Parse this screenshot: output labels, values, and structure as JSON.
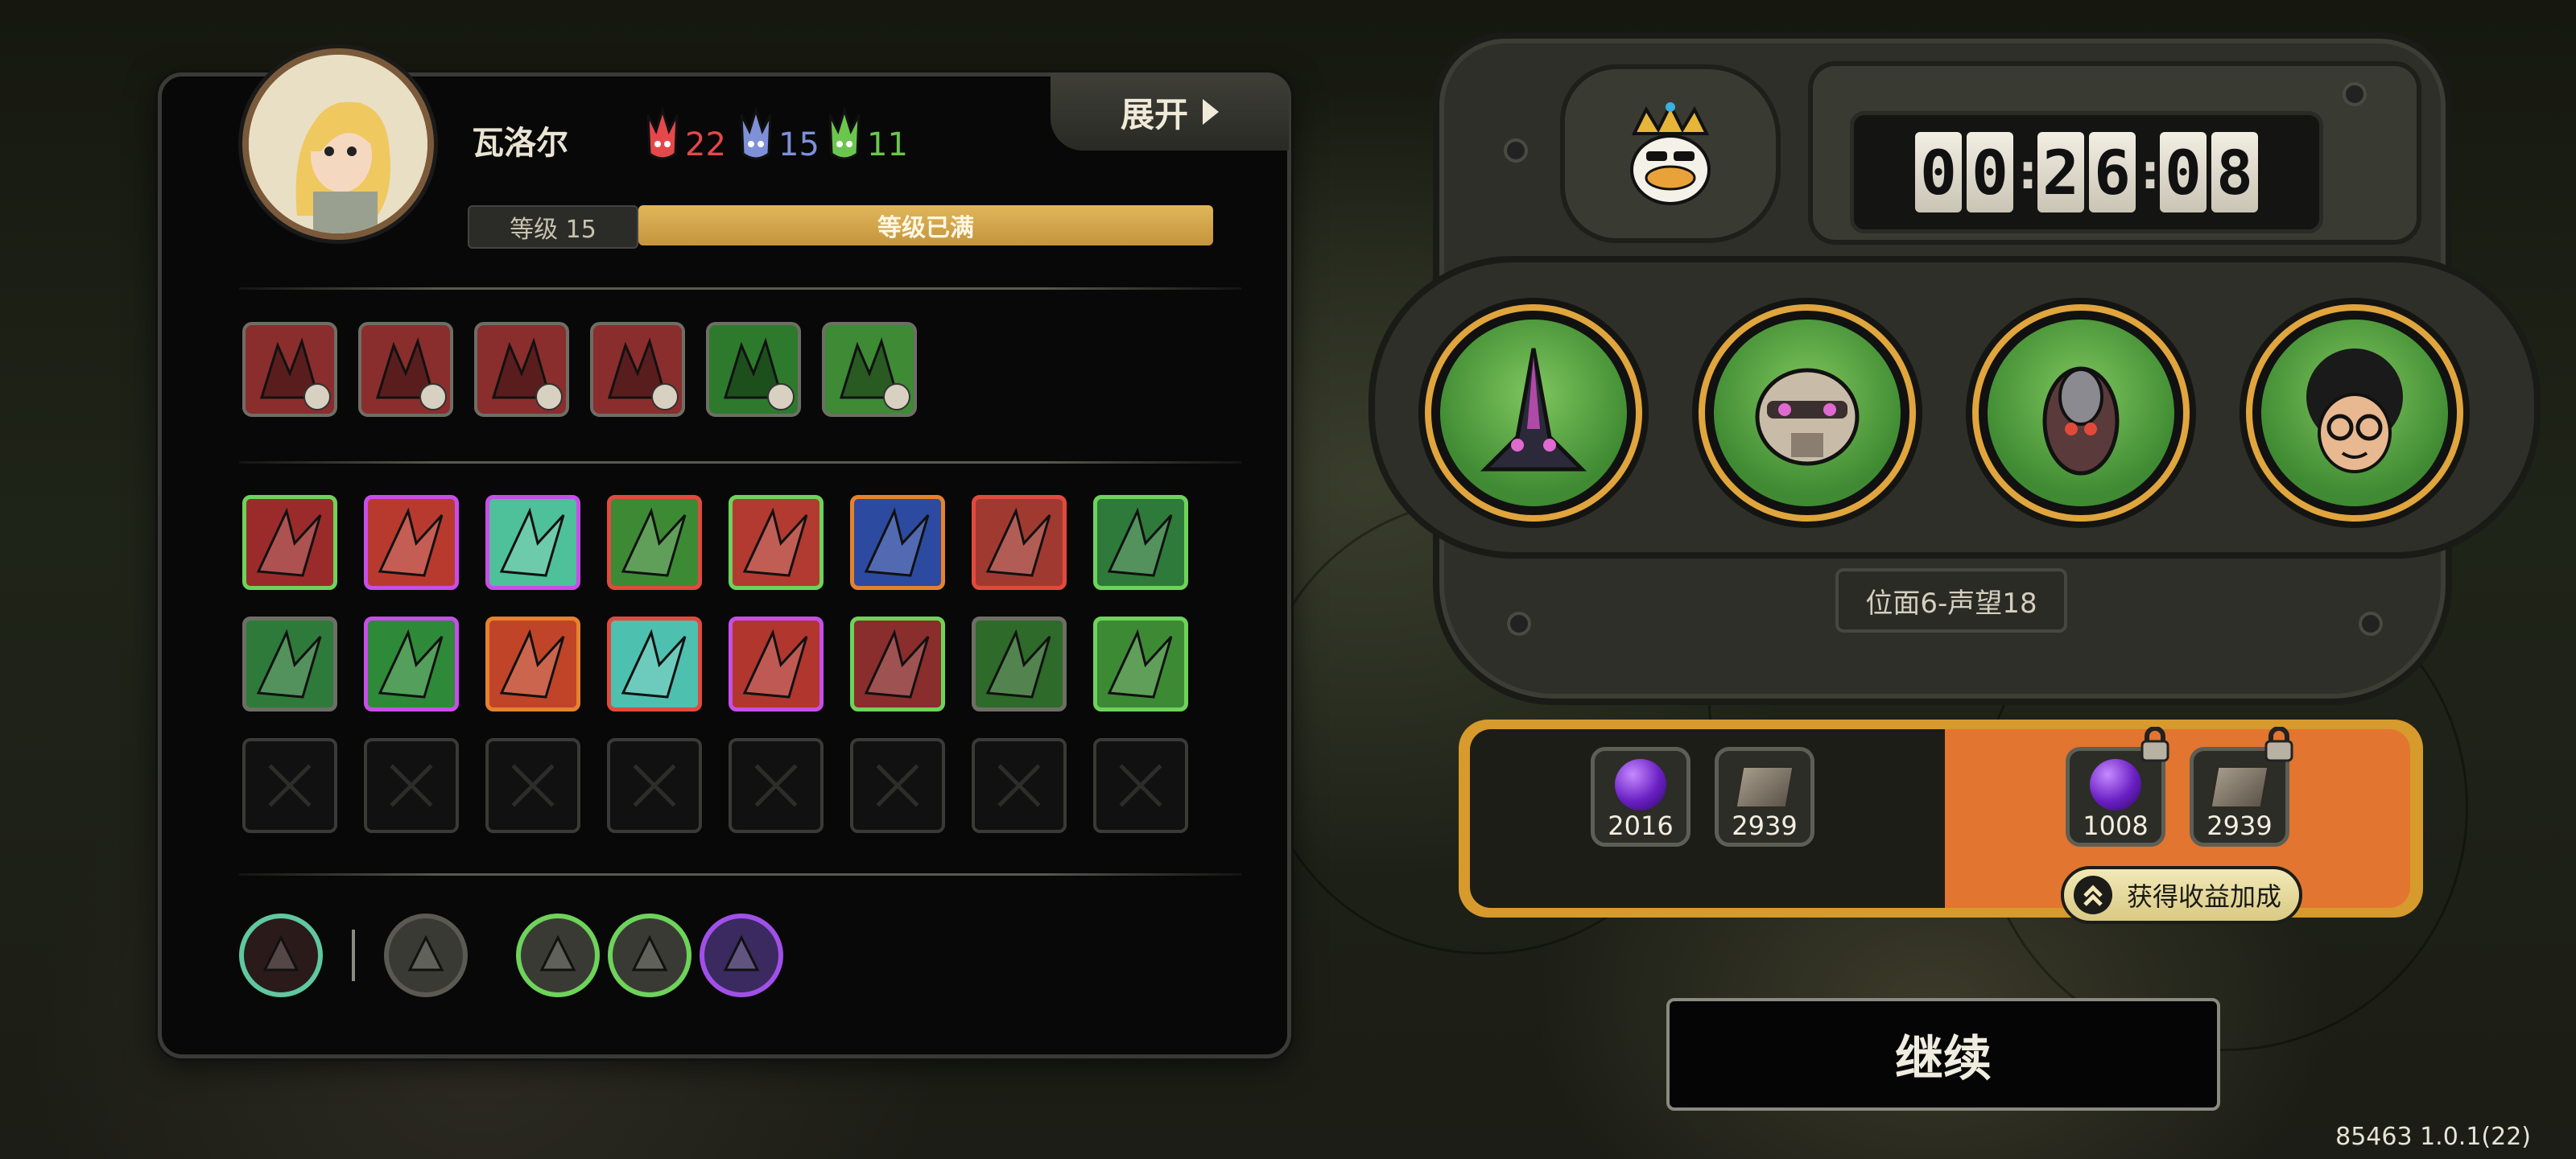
{
  "hero": {
    "name": "瓦洛尔",
    "expand_label": "展开",
    "stats": [
      {
        "icon": "red-mask-icon",
        "value": "22",
        "color": "#e4484a"
      },
      {
        "icon": "blue-mask-icon",
        "value": "15",
        "color": "#7e90d8"
      },
      {
        "icon": "green-mask-icon",
        "value": "11",
        "color": "#6cc54e"
      }
    ],
    "level_label": "等级 15",
    "level_status": "等级已满"
  },
  "equipment": [
    {
      "name": "equip-claw-icon",
      "bg": "#8a2d2d"
    },
    {
      "name": "equip-fire-icon",
      "bg": "#8a2d2d"
    },
    {
      "name": "equip-beast-icon",
      "bg": "#8a2d2d"
    },
    {
      "name": "equip-helmet-icon",
      "bg": "#8a2d2d"
    },
    {
      "name": "equip-leaf-icon",
      "bg": "#2d7a2d"
    },
    {
      "name": "equip-armor-icon",
      "bg": "#3e8a35"
    }
  ],
  "skills": [
    {
      "name": "skill-red-beast-icon",
      "bg": "#9b2b2b",
      "border": "#6ed35a"
    },
    {
      "name": "skill-lightning-icon",
      "bg": "#b83a2e",
      "border": "#c84ee8"
    },
    {
      "name": "skill-burst-icon",
      "bg": "#4ec09a",
      "border": "#c84ee8"
    },
    {
      "name": "skill-shield-icon",
      "bg": "#3d8a35",
      "border": "#e24a3e"
    },
    {
      "name": "skill-slash-icon",
      "bg": "#b33a30",
      "border": "#6ed35a"
    },
    {
      "name": "skill-tooth-icon",
      "bg": "#2c4aa0",
      "border": "#e6822e"
    },
    {
      "name": "skill-fist-icon",
      "bg": "#a03a30",
      "border": "#e24a3e"
    },
    {
      "name": "skill-crystal-icon",
      "bg": "#2e7a3a",
      "border": "#6ed35a"
    },
    {
      "name": "skill-spikes-icon",
      "bg": "#2e7a3a",
      "border": "#6e6e66"
    },
    {
      "name": "skill-wind-icon",
      "bg": "#2e8a38",
      "border": "#c84ee8"
    },
    {
      "name": "skill-demon-face-icon",
      "bg": "#c04428",
      "border": "#e6822e"
    },
    {
      "name": "skill-wave-icon",
      "bg": "#4ec0b0",
      "border": "#e24a3e"
    },
    {
      "name": "skill-figure-icon",
      "bg": "#b0362e",
      "border": "#c84ee8"
    },
    {
      "name": "skill-blades-icon",
      "bg": "#8a2d2d",
      "border": "#6ed35a"
    },
    {
      "name": "skill-mantis-icon",
      "bg": "#2e6a2a",
      "border": "#6e6e66"
    },
    {
      "name": "skill-pink-flame-icon",
      "bg": "#3d8a35",
      "border": "#6ed35a"
    }
  ],
  "empty_slot_count": 8,
  "bottom_icons": [
    {
      "name": "demon-emblem-icon",
      "ring": "#5fc8a0",
      "fill": "#2b1a1a"
    },
    {
      "name": "dagger-icon",
      "ring": "#5a5a52",
      "fill": "#3a3a34"
    },
    {
      "name": "rune-circle-icon",
      "ring": "#6ed35a",
      "fill": "#3a3a34"
    },
    {
      "name": "potion-icon",
      "ring": "#6ed35a",
      "fill": "#3a3a34"
    },
    {
      "name": "gold-crest-icon",
      "ring": "#a050e8",
      "fill": "#3a2a60"
    }
  ],
  "timer": {
    "digits": [
      "0",
      "0",
      "2",
      "6",
      "0",
      "8"
    ]
  },
  "party": [
    {
      "name": "party-mantis-icon"
    },
    {
      "name": "party-robot-icon"
    },
    {
      "name": "party-beetle-icon"
    },
    {
      "name": "party-curly-hair-icon"
    }
  ],
  "plane_label": "位面6-声望18",
  "rewards": {
    "base": [
      {
        "type": "purple-orb-icon",
        "amount": "2016"
      },
      {
        "type": "book-icon",
        "amount": "2939"
      }
    ],
    "bonus": [
      {
        "type": "purple-orb-icon",
        "amount": "1008"
      },
      {
        "type": "book-icon",
        "amount": "2939"
      }
    ],
    "bonus_button": "获得收益加成",
    "colors": {
      "frame": "#d79a2d",
      "bonus_bg": "#e27530"
    }
  },
  "continue_label": "继续",
  "version": "85463 1.0.1(22)"
}
